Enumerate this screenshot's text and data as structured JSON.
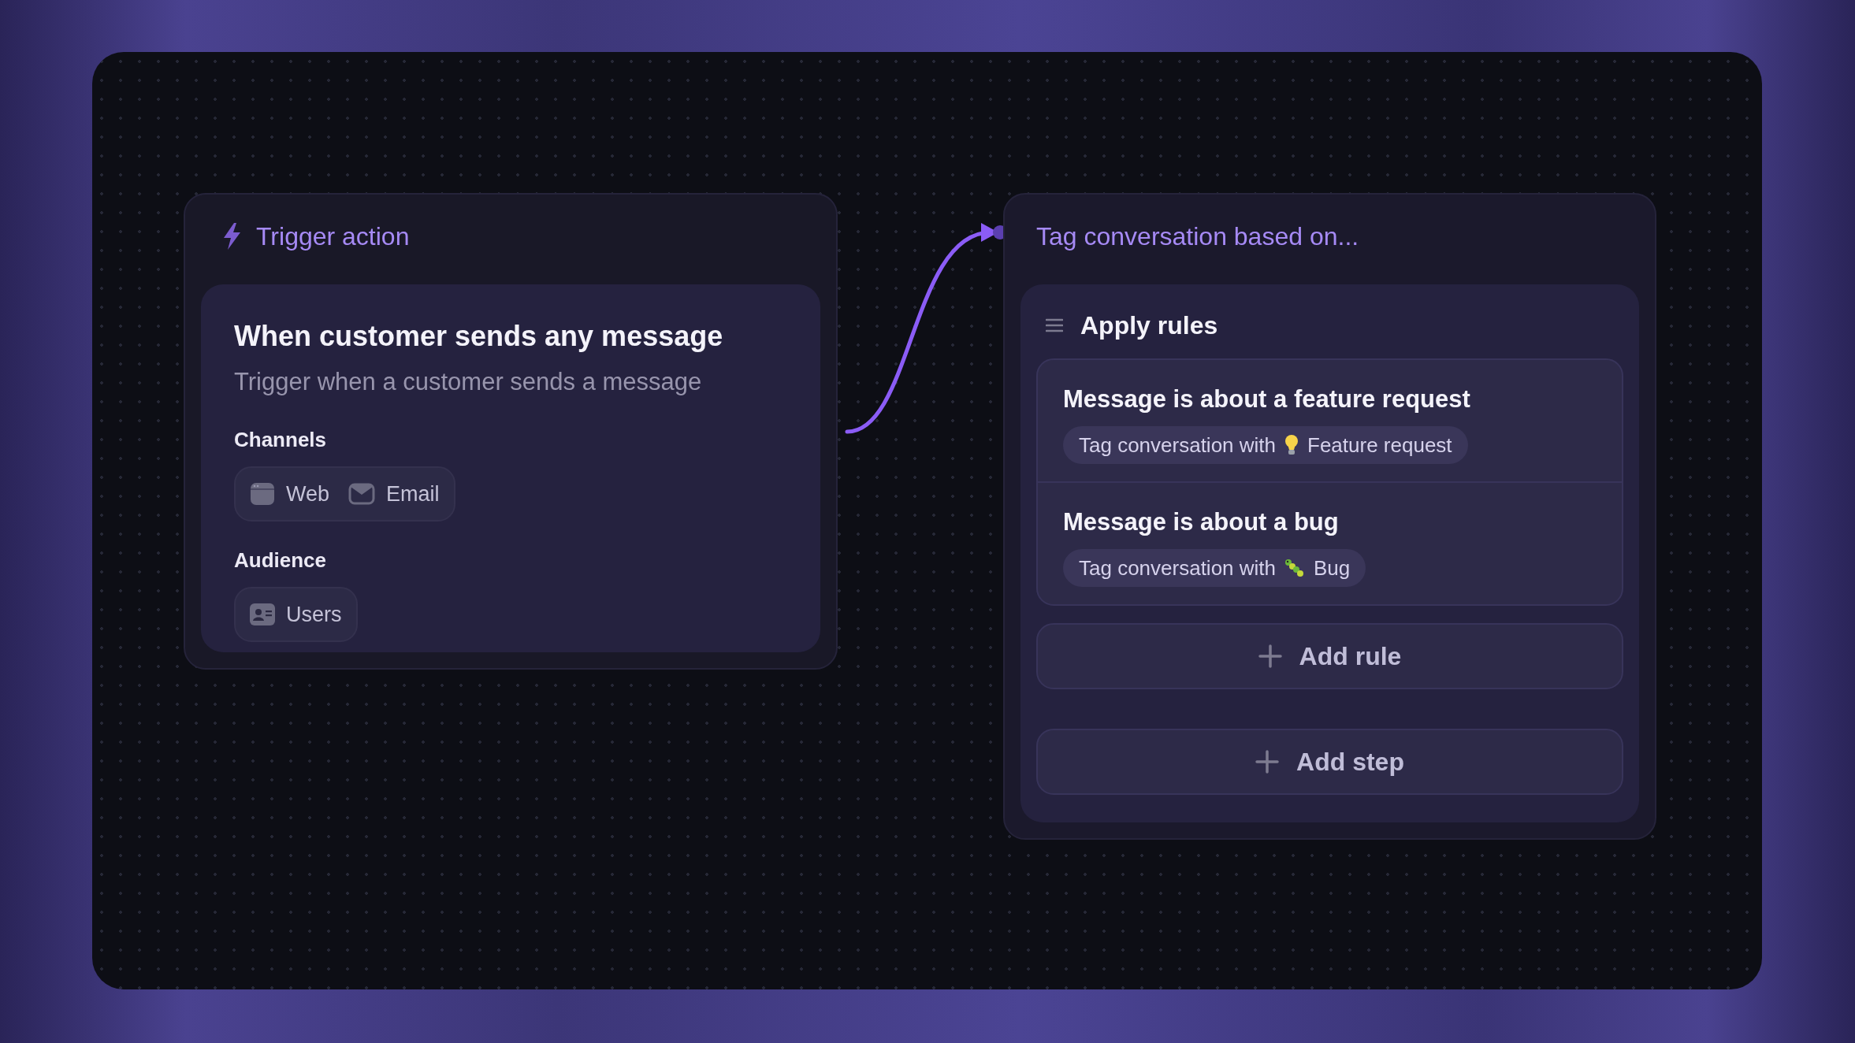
{
  "trigger": {
    "header": "Trigger action",
    "title": "When customer sends any message",
    "description": "Trigger when a customer sends a message",
    "sections": [
      {
        "label": "Channels",
        "items": [
          {
            "kind": "web",
            "label": "Web"
          },
          {
            "kind": "email",
            "label": "Email"
          }
        ]
      },
      {
        "label": "Audience",
        "items": [
          {
            "kind": "users",
            "label": "Users"
          }
        ]
      }
    ]
  },
  "step": {
    "header": "Tag conversation based on...",
    "title": "Apply rules",
    "rules": [
      {
        "title": "Message is about a feature request",
        "action": "Tag conversation with",
        "tag": {
          "kind": "lightbulb",
          "label": "Feature request"
        }
      },
      {
        "title": "Message is about a bug",
        "action": "Tag conversation with",
        "tag": {
          "kind": "bug",
          "label": "Bug"
        }
      }
    ],
    "add_rule": "Add rule"
  },
  "add_step": "Add step"
}
